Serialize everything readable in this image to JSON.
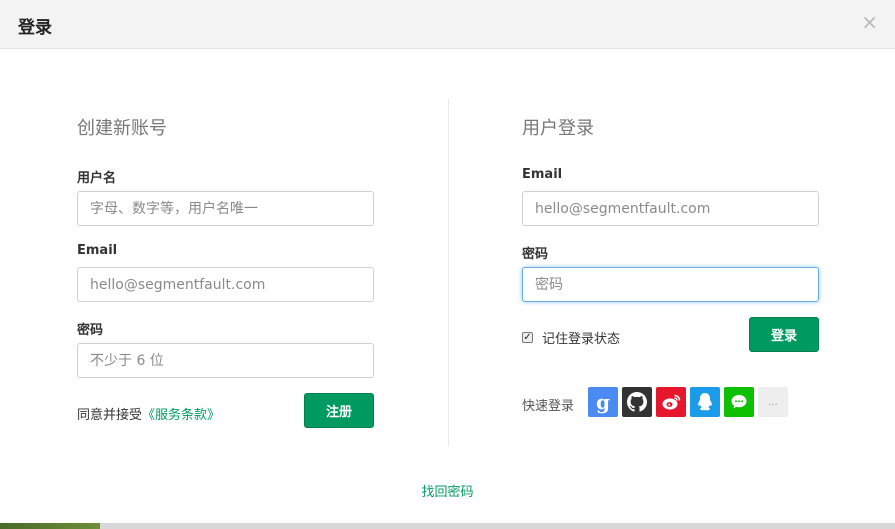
{
  "modal": {
    "title": "登录",
    "close_label": "×"
  },
  "register": {
    "heading": "创建新账号",
    "username_label": "用户名",
    "username_placeholder": "字母、数字等，用户名唯一",
    "email_label": "Email",
    "email_placeholder": "hello@segmentfault.com",
    "password_label": "密码",
    "password_placeholder": "不少于 6 位",
    "agree_text": "同意并接受",
    "terms_link": "《服务条款》",
    "submit_label": "注册"
  },
  "login": {
    "heading": "用户登录",
    "email_label": "Email",
    "email_placeholder": "hello@segmentfault.com",
    "password_label": "密码",
    "password_placeholder": "密码",
    "remember_label": "记住登录状态",
    "remember_checked": true,
    "submit_label": "登录",
    "quick_login_label": "快速登录",
    "social": [
      {
        "icon": "google-icon",
        "color": "#4c8af3"
      },
      {
        "icon": "github-icon",
        "color": "#333333"
      },
      {
        "icon": "weibo-icon",
        "color": "#e6162d"
      },
      {
        "icon": "qq-icon",
        "color": "#1a9ce8"
      },
      {
        "icon": "wechat-icon",
        "color": "#0fc000"
      },
      {
        "icon": "more-icon",
        "color": "#eeeeee",
        "label": "..."
      }
    ]
  },
  "footer": {
    "forgot_password": "找回密码"
  },
  "colors": {
    "accent": "#009a61",
    "focus_border": "#66afe9"
  }
}
